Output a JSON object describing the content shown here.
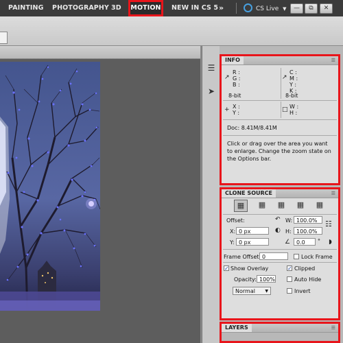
{
  "menubar": {
    "workspaces": [
      "PAINTING",
      "PHOTOGRAPHY",
      "3D",
      "MOTION",
      "NEW IN CS 5"
    ],
    "overflow_icon": "double-chevron-right",
    "cs_live": "CS Live",
    "cs_live_icon": "cs-live-ring-icon",
    "dropdown_icon": "chevron-down",
    "window_buttons": [
      "minimize",
      "restore",
      "close"
    ]
  },
  "info": {
    "title": "INFO",
    "rgb_labels": [
      "R :",
      "G :",
      "B :"
    ],
    "cmyk_labels": [
      "C :",
      "M :",
      "Y :",
      "K :"
    ],
    "bit_left": "8-bit",
    "bit_right": "8-bit",
    "xy_labels": [
      "X :",
      "Y :"
    ],
    "wh_labels": [
      "W :",
      "H :"
    ],
    "doc": "Doc: 8.41M/8.41M",
    "hint": "Click or drag over the area you want to enlarge. Change the zoom state on the Options bar."
  },
  "clone": {
    "title": "CLONE SOURCE",
    "offset_label": "Offset:",
    "x_label": "X:",
    "x_value": "0 px",
    "y_label": "Y:",
    "y_value": "0 px",
    "w_label": "W:",
    "w_value": "100.0%",
    "h_label": "H:",
    "h_value": "100.0%",
    "angle_value": "0.0",
    "degree": "°",
    "frame_offset_label": "Frame Offset:",
    "frame_offset_value": "0",
    "lock_frame": "Lock Frame",
    "show_overlay": "Show Overlay",
    "clipped": "Clipped",
    "opacity_label": "Opacity:",
    "opacity_value": "100%",
    "auto_hide": "Auto Hide",
    "mode_value": "Normal",
    "invert": "Invert"
  },
  "layers": {
    "title": "LAYERS"
  }
}
